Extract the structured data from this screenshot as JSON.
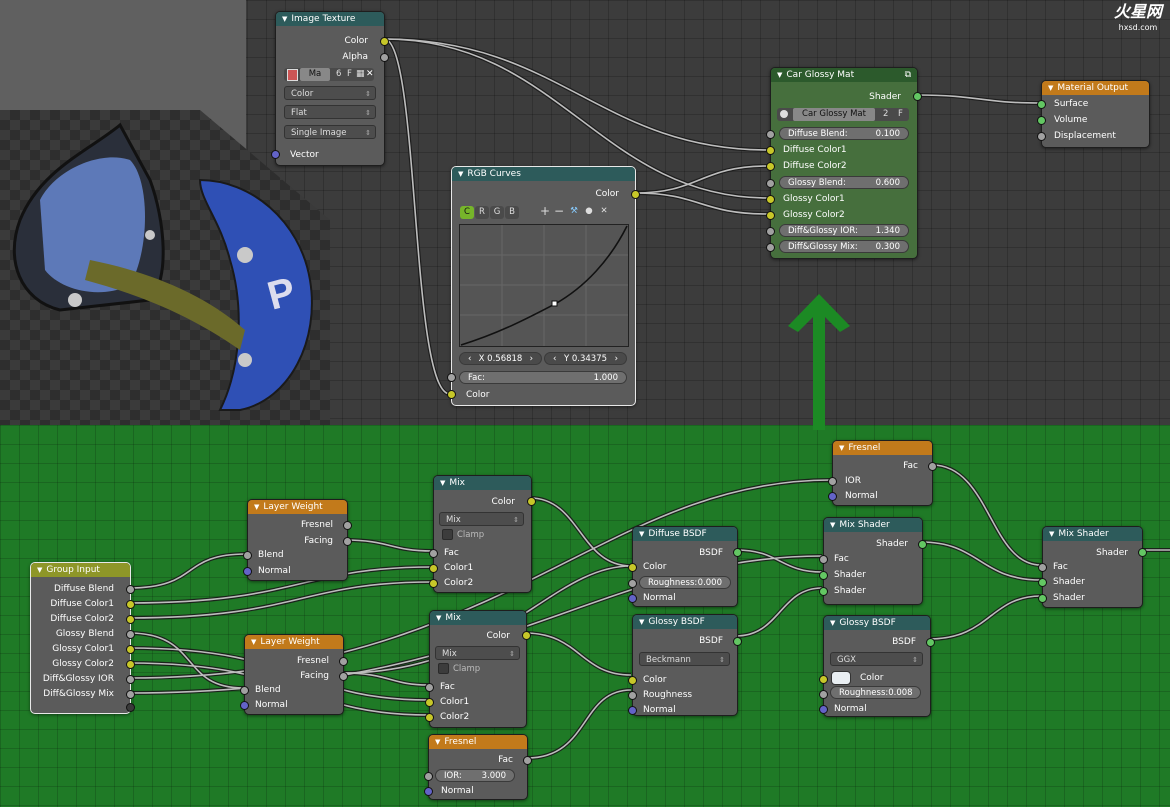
{
  "watermark": {
    "logo": "火星网",
    "url": "hxsd.com"
  },
  "viewport_text": "P",
  "image_texture": {
    "title": "Image Texture",
    "out_color": "Color",
    "out_alpha": "Alpha",
    "img_name": "Ma",
    "users": "6",
    "fake": "F",
    "color_mode": "Color",
    "projection": "Flat",
    "source": "Single Image",
    "in_vector": "Vector"
  },
  "rgb_curves": {
    "title": "RGB Curves",
    "out_color": "Color",
    "tab_c": "C",
    "tab_r": "R",
    "tab_g": "G",
    "tab_b": "B",
    "x_value": "X 0.56818",
    "y_value": "Y 0.34375",
    "fac_label": "Fac:",
    "fac_value": "1.000",
    "in_color": "Color"
  },
  "car_glossy": {
    "title": "Car Glossy Mat",
    "out_shader": "Shader",
    "group_name": "Car Glossy Mat",
    "users": "2",
    "fake": "F",
    "diffuse_blend_label": "Diffuse Blend:",
    "diffuse_blend_value": "0.100",
    "diffuse_color1": "Diffuse Color1",
    "diffuse_color2": "Diffuse Color2",
    "glossy_blend_label": "Glossy Blend:",
    "glossy_blend_value": "0.600",
    "glossy_color1": "Glossy Color1",
    "glossy_color2": "Glossy Color2",
    "ior_label": "Diff&Glossy IOR:",
    "ior_value": "1.340",
    "mix_label": "Diff&Glossy Mix:",
    "mix_value": "0.300"
  },
  "material_output": {
    "title": "Material Output",
    "surface": "Surface",
    "volume": "Volume",
    "displacement": "Displacement"
  },
  "group_input": {
    "title": "Group Input",
    "outputs": [
      "Diffuse Blend",
      "Diffuse Color1",
      "Diffuse Color2",
      "Glossy Blend",
      "Glossy Color1",
      "Glossy Color2",
      "Diff&Glossy IOR",
      "Diff&Glossy Mix"
    ]
  },
  "layer_weight_1": {
    "title": "Layer Weight",
    "fresnel": "Fresnel",
    "facing": "Facing",
    "blend": "Blend",
    "normal": "Normal"
  },
  "layer_weight_2": {
    "title": "Layer Weight",
    "fresnel": "Fresnel",
    "facing": "Facing",
    "blend": "Blend",
    "normal": "Normal"
  },
  "mix_1": {
    "title": "Mix",
    "out_color": "Color",
    "blend_type": "Mix",
    "clamp": "Clamp",
    "fac": "Fac",
    "color1": "Color1",
    "color2": "Color2"
  },
  "mix_2": {
    "title": "Mix",
    "out_color": "Color",
    "blend_type": "Mix",
    "clamp": "Clamp",
    "fac": "Fac",
    "color1": "Color1",
    "color2": "Color2"
  },
  "fresnel_1": {
    "title": "Fresnel",
    "fac": "Fac",
    "ior": "IOR",
    "normal": "Normal"
  },
  "fresnel_2": {
    "title": "Fresnel",
    "fac": "Fac",
    "ior_label": "IOR:",
    "ior_value": "3.000",
    "normal": "Normal"
  },
  "diffuse_bsdf": {
    "title": "Diffuse BSDF",
    "out": "BSDF",
    "color": "Color",
    "roughness_label": "Roughness:",
    "roughness_value": "0.000",
    "normal": "Normal"
  },
  "glossy_bsdf_1": {
    "title": "Glossy BSDF",
    "out": "BSDF",
    "distribution": "Beckmann",
    "color": "Color",
    "roughness": "Roughness",
    "normal": "Normal"
  },
  "glossy_bsdf_2": {
    "title": "Glossy BSDF",
    "out": "BSDF",
    "distribution": "GGX",
    "color": "Color",
    "roughness_label": "Roughness:",
    "roughness_value": "0.008",
    "normal": "Normal"
  },
  "mix_shader_1": {
    "title": "Mix Shader",
    "out": "Shader",
    "fac": "Fac",
    "shader1": "Shader",
    "shader2": "Shader"
  },
  "mix_shader_2": {
    "title": "Mix Shader",
    "out": "Shader",
    "fac": "Fac",
    "shader1": "Shader",
    "shader2": "Shader"
  }
}
